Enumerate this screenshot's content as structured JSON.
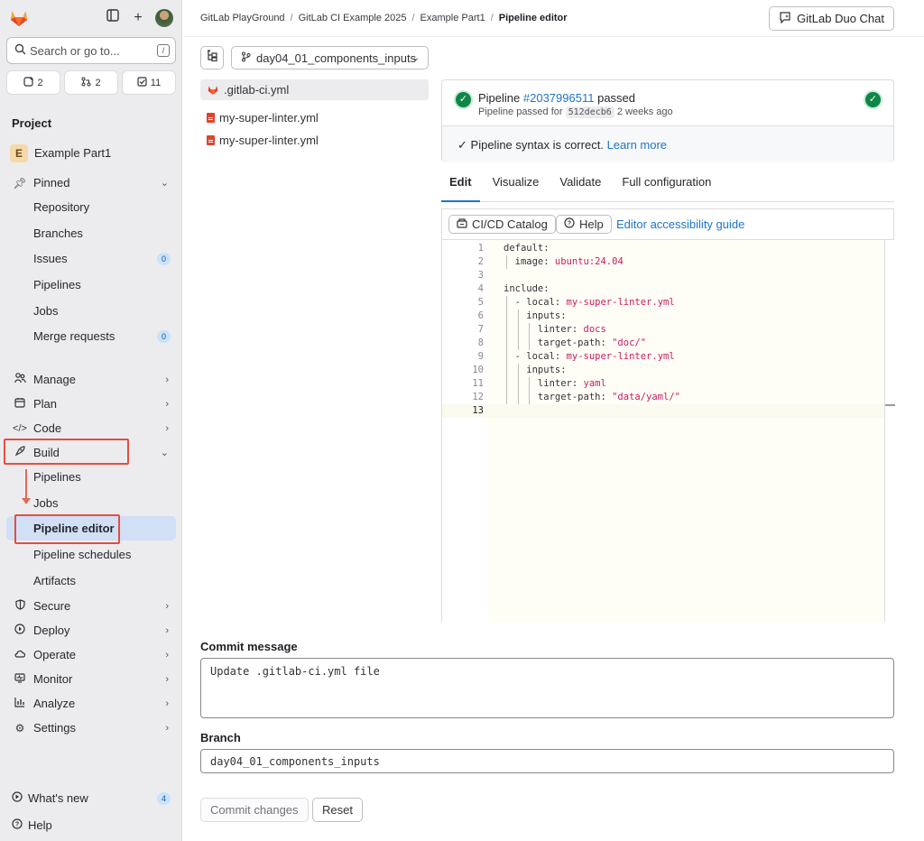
{
  "sidebar": {
    "search_placeholder": "Search or go to...",
    "search_shortcut": "/",
    "counters": [
      {
        "icon": "issues-icon",
        "count": "2"
      },
      {
        "icon": "merge-request-icon",
        "count": "2"
      },
      {
        "icon": "todo-icon",
        "count": "11"
      }
    ],
    "section_label": "Project",
    "project_initial": "E",
    "project_name": "Example Part1",
    "pinned": {
      "label": "Pinned",
      "items": [
        {
          "label": "Repository"
        },
        {
          "label": "Branches"
        },
        {
          "label": "Issues",
          "badge": "0"
        },
        {
          "label": "Pipelines"
        },
        {
          "label": "Jobs"
        },
        {
          "label": "Merge requests",
          "badge": "0"
        }
      ]
    },
    "groups": {
      "manage": "Manage",
      "plan": "Plan",
      "code": "Code",
      "build": "Build",
      "secure": "Secure",
      "deploy": "Deploy",
      "operate": "Operate",
      "monitor": "Monitor",
      "analyze": "Analyze",
      "settings": "Settings"
    },
    "build_items": [
      "Pipelines",
      "Jobs",
      "Pipeline editor",
      "Pipeline schedules",
      "Artifacts"
    ],
    "whats_new": {
      "label": "What's new",
      "badge": "4"
    },
    "help": "Help"
  },
  "header": {
    "breadcrumbs": [
      "GitLab PlayGround",
      "GitLab CI Example 2025",
      "Example Part1",
      "Pipeline editor"
    ],
    "duo_button": "GitLab Duo Chat"
  },
  "editor": {
    "branch": "day04_01_components_inputs",
    "files": [
      {
        "name": ".gitlab-ci.yml",
        "icon": "gitlab-fox-icon"
      },
      {
        "name": "my-super-linter.yml",
        "icon": "yaml-file-icon"
      },
      {
        "name": "my-super-linter.yml",
        "icon": "yaml-file-icon"
      }
    ],
    "pipeline": {
      "prefix": "Pipeline",
      "id": "#2037996511",
      "status": "passed",
      "sub_prefix": "Pipeline passed for",
      "sha": "512decb6",
      "time": "2 weeks ago",
      "syntax_msg": "Pipeline syntax is correct.",
      "learn_more": "Learn more"
    },
    "tabs": [
      "Edit",
      "Visualize",
      "Validate",
      "Full configuration"
    ],
    "toolbar": {
      "catalog": "CI/CD Catalog",
      "help": "Help",
      "a11y": "Editor accessibility guide"
    },
    "code_lines": [
      {
        "n": "1",
        "k": "default:",
        "s": ""
      },
      {
        "n": "2",
        "k": "  image: ",
        "s": "ubuntu:24.04"
      },
      {
        "n": "3",
        "k": "",
        "s": ""
      },
      {
        "n": "4",
        "k": "include:",
        "s": ""
      },
      {
        "n": "5",
        "k": "  - local: ",
        "s": "my-super-linter.yml"
      },
      {
        "n": "6",
        "k": "    inputs:",
        "s": ""
      },
      {
        "n": "7",
        "k": "      linter: ",
        "s": "docs"
      },
      {
        "n": "8",
        "k": "      target-path: ",
        "s": "\"doc/\""
      },
      {
        "n": "9",
        "k": "  - local: ",
        "s": "my-super-linter.yml"
      },
      {
        "n": "10",
        "k": "    inputs:",
        "s": ""
      },
      {
        "n": "11",
        "k": "      linter: ",
        "s": "yaml"
      },
      {
        "n": "12",
        "k": "      target-path: ",
        "s": "\"data/yaml/\""
      },
      {
        "n": "13",
        "k": "",
        "s": ""
      }
    ]
  },
  "commit": {
    "message_label": "Commit message",
    "message": "Update .gitlab-ci.yml file",
    "branch_label": "Branch",
    "branch": "day04_01_components_inputs",
    "commit_button": "Commit changes",
    "reset_button": "Reset"
  }
}
